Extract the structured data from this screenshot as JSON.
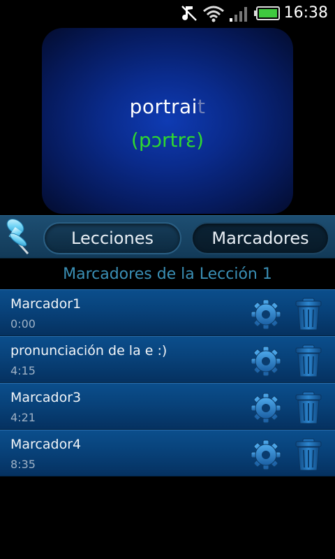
{
  "status_bar": {
    "time": "16:38",
    "icons": [
      "music-mute-icon",
      "wifi-icon",
      "signal-icon",
      "battery-icon"
    ]
  },
  "word_display": {
    "word_main": "portrai",
    "word_faded": "t",
    "phonetic": "(pɔrtrɛ)",
    "colors": {
      "phonetic": "#2fd92f",
      "panel": "#0a2b8c"
    }
  },
  "tabs": {
    "icon": "pushpin-icon",
    "items": [
      {
        "label": "Lecciones"
      },
      {
        "label": "Marcadores"
      }
    ]
  },
  "section_title": "Marcadores de la Lección 1",
  "bookmarks": [
    {
      "name": "Marcador1",
      "time": "0:00"
    },
    {
      "name": "pronunciación de la e :)",
      "time": "4:15"
    },
    {
      "name": "Marcador3",
      "time": "4:21"
    },
    {
      "name": "Marcador4",
      "time": "8:35"
    }
  ],
  "row_icons": [
    "gear-icon",
    "trash-icon"
  ]
}
